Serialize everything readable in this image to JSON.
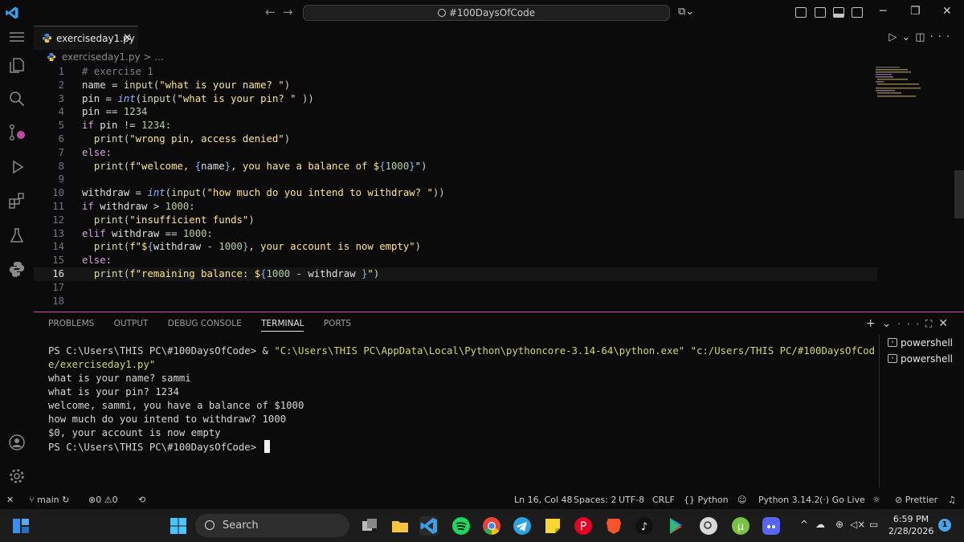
{
  "titlebar": {
    "search_text": "#100DaysOfCode"
  },
  "editor": {
    "tab_label": "exerciseday1.py",
    "breadcrumb_file": "exerciseday1.py",
    "breadcrumb_more": "> ...",
    "line_numbers": [
      "1",
      "2",
      "3",
      "4",
      "5",
      "6",
      "7",
      "8",
      "9",
      "10",
      "11",
      "12",
      "13",
      "14",
      "15",
      "16",
      "17",
      "18"
    ],
    "current_line": 16
  },
  "panel": {
    "tabs": [
      "PROBLEMS",
      "OUTPUT",
      "DEBUG CONSOLE",
      "TERMINAL",
      "PORTS"
    ],
    "active_tab": "TERMINAL",
    "terminals": [
      "powershell",
      "powershell"
    ],
    "output": {
      "l1_prompt": "PS C:\\Users\\THIS PC\\#100DaysOfCode> & ",
      "l1_exe": "\"C:\\Users\\THIS PC\\AppData\\Local\\Python\\pythoncore-3.14-64\\python.exe\"",
      "l1_script": " \"c:/Users/THIS PC/#100DaysOfCode/exerciseday1.py\"",
      "l2": "what is your name? sammi",
      "l3": "what is your pin? 1234",
      "l4": "welcome, sammi, you have a balance of $1000",
      "l5": "how much do you intend to withdraw? 1000",
      "l6": "$0, your account is now empty",
      "l7": "PS C:\\Users\\THIS PC\\#100DaysOfCode> "
    }
  },
  "statusbar": {
    "branch": "main",
    "errors": "0",
    "warnings": "0",
    "position": "Ln 16, Col 48",
    "spaces": "Spaces: 2",
    "encoding": "UTF-8",
    "eol": "CRLF",
    "language": "Python",
    "interpreter": "Python 3.14.2",
    "go_live": "Go Live",
    "prettier": "Prettier"
  },
  "taskbar": {
    "search_label": "Search",
    "time": "6:59 PM",
    "date": "2/28/2026",
    "notifications": "1"
  },
  "colors": {
    "panel_border": "#d24aa9",
    "status_accent": "#4aa3f0"
  }
}
